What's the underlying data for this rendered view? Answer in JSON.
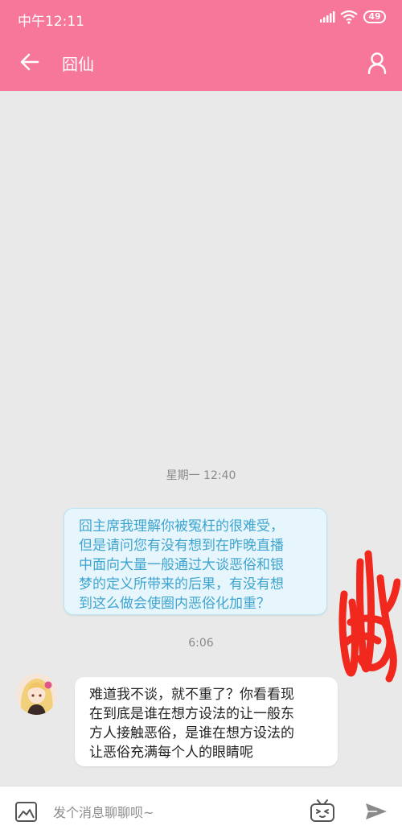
{
  "status_bar": {
    "time": "中午12:11",
    "battery": "49",
    "icons": [
      "signal-icon",
      "wifi-icon",
      "battery-icon"
    ]
  },
  "header": {
    "title": "囧仙",
    "left_icon": "back-arrow-icon",
    "right_icon": "user-profile-icon"
  },
  "colors": {
    "header_bg": "#f7779a",
    "chat_bg": "#e9e9e9",
    "outgoing_bubble_bg": "#e6f6fc",
    "outgoing_text": "#3fa4d0",
    "incoming_bubble_bg": "#ffffff",
    "incoming_text": "#222222",
    "timestamp_text": "#8a8a8a",
    "redaction_scribble": "#f0281e"
  },
  "messages": [
    {
      "type": "timestamp",
      "text": "星期一 12:40"
    },
    {
      "type": "outgoing",
      "lines": [
        "囧主席我理解你被冤枉的很难受，",
        "但是请问您有没有想到在昨晚直播",
        "中面向大量一般通过大谈恶俗和银",
        "梦的定义所带来的后果，有没有想",
        "到这么做会使圈内恶俗化加重？"
      ]
    },
    {
      "type": "timestamp",
      "text": "6:06"
    },
    {
      "type": "incoming",
      "lines": [
        "难道我不谈，就不重了？你看看现",
        "在到底是谁在想方设法的让一般东",
        "方人接触恶俗，是谁在想方设法的",
        "让恶俗充满每个人的眼睛呢"
      ]
    }
  ],
  "input_bar": {
    "placeholder": "发个消息聊聊呗~",
    "value": "",
    "icons": [
      "image-icon",
      "emoji-tv-icon",
      "send-icon"
    ]
  }
}
